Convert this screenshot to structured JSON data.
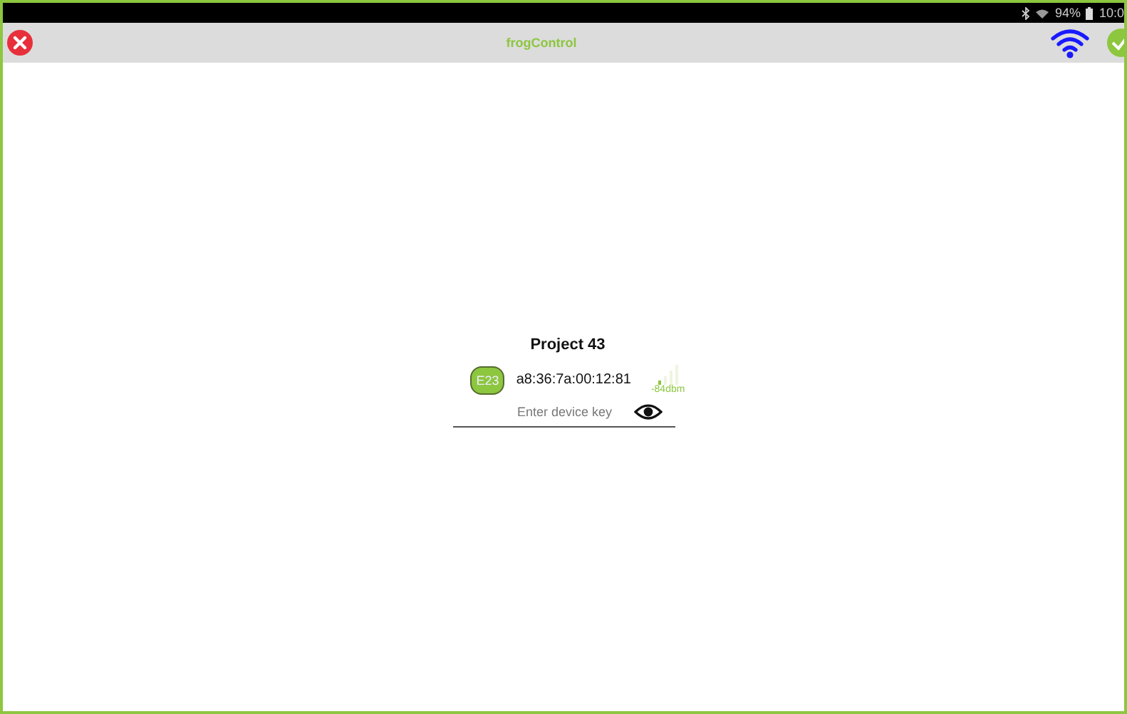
{
  "status_bar": {
    "battery": "94%",
    "time": "10:0"
  },
  "app_bar": {
    "title": "frogControl"
  },
  "project": {
    "name": "Project 43"
  },
  "device": {
    "badge": "E23",
    "address": "a8:36:7a:00:12:81",
    "signal": "-84dbm"
  },
  "key_field": {
    "placeholder": "Enter device key"
  }
}
